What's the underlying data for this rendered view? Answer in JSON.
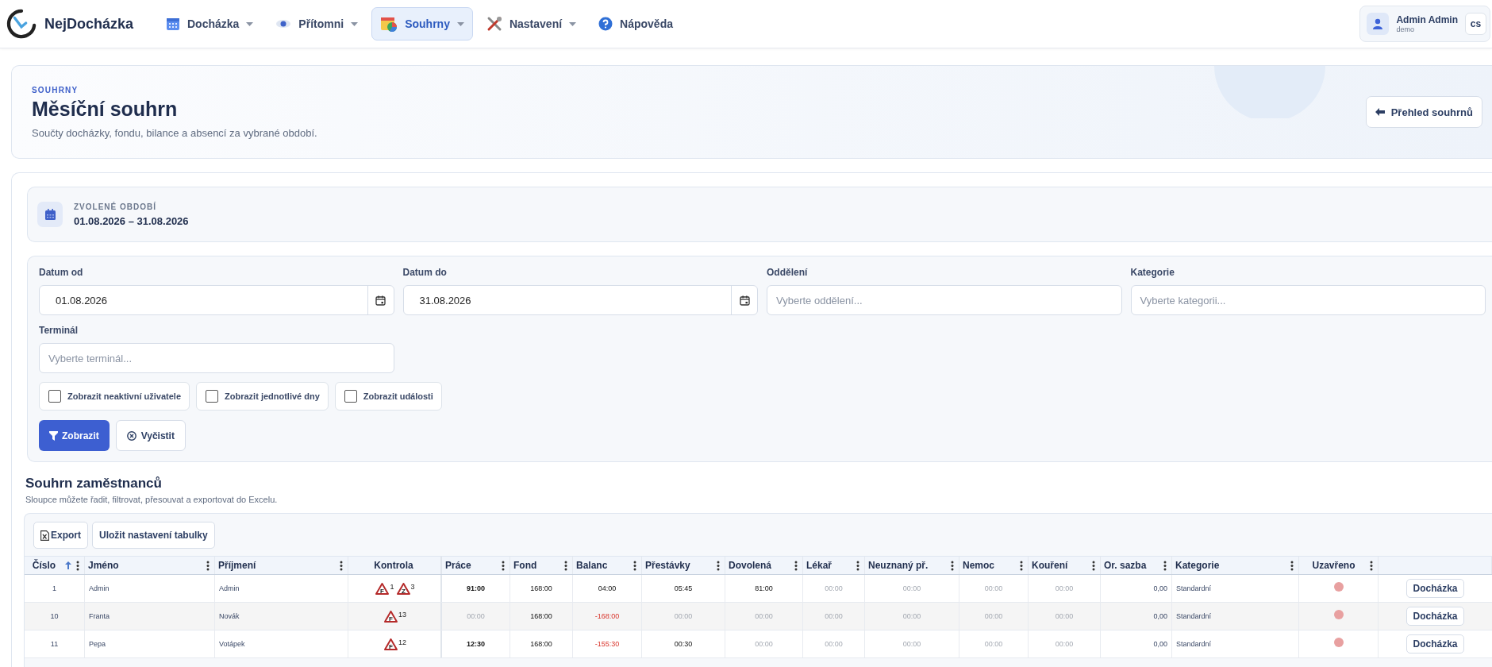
{
  "brand": {
    "name": "NejDocházka"
  },
  "nav": [
    {
      "label": "Docházka",
      "has_menu": true,
      "selected": false
    },
    {
      "label": "Přítomni",
      "has_menu": true,
      "selected": false
    },
    {
      "label": "Souhrny",
      "has_menu": true,
      "selected": true
    },
    {
      "label": "Nastavení",
      "has_menu": true,
      "selected": false
    },
    {
      "label": "Nápověda",
      "has_menu": false,
      "selected": false
    }
  ],
  "user": {
    "name": "Admin Admin",
    "company": "demo",
    "language": "cs"
  },
  "header": {
    "eyebrow": "SOUHRNY",
    "title": "Měsíční souhrn",
    "subtitle": "Součty docházky, fondu, bilance a absencí za vybrané období.",
    "back_button": "Přehled souhrnů"
  },
  "period": {
    "label": "ZVOLENÉ OBDOBÍ",
    "value": "01.08.2026 – 31.08.2026"
  },
  "filters": {
    "fields": [
      {
        "label": "Datum od",
        "kind": "date",
        "value": "01.08.2026"
      },
      {
        "label": "Datum do",
        "kind": "date",
        "value": "31.08.2026"
      },
      {
        "label": "Oddělení",
        "kind": "select",
        "placeholder": "Vyberte oddělení..."
      },
      {
        "label": "Kategorie",
        "kind": "select",
        "placeholder": "Vyberte kategorii..."
      },
      {
        "label": "Terminál",
        "kind": "select",
        "placeholder": "Vyberte terminál..."
      }
    ],
    "checkboxes": [
      {
        "label": "Zobrazit neaktivní uživatele",
        "checked": false
      },
      {
        "label": "Zobrazit jednotlivé dny",
        "checked": false
      },
      {
        "label": "Zobrazit události",
        "checked": false
      }
    ],
    "submit": "Zobrazit",
    "clear": "Vyčistit"
  },
  "summary": {
    "title": "Souhrn zaměstnanců",
    "subtitle": "Sloupce můžete řadit, filtrovat, přesouvat a exportovat do Excelu.",
    "export_button": "Export",
    "save_button": "Uložit nastavení tabulky",
    "columns": [
      {
        "label": "Číslo",
        "sorted_ascending": true,
        "menu": true
      },
      {
        "label": "Jméno",
        "menu": true
      },
      {
        "label": "Příjmení",
        "menu": true
      },
      {
        "label": "Kontrola",
        "menu": false
      },
      {
        "label": "Práce",
        "menu": true
      },
      {
        "label": "Fond",
        "menu": true
      },
      {
        "label": "Balanc",
        "menu": true
      },
      {
        "label": "Přestávky",
        "menu": true
      },
      {
        "label": "Dovolená",
        "menu": true
      },
      {
        "label": "Lékař",
        "menu": true
      },
      {
        "label": "Neuznaný př.",
        "menu": true
      },
      {
        "label": "Nemoc",
        "menu": true
      },
      {
        "label": "Kouření",
        "menu": true
      },
      {
        "label": "Or. sazba",
        "menu": true
      },
      {
        "label": "Kategorie",
        "menu": true
      },
      {
        "label": "Uzavřeno",
        "menu": true
      }
    ],
    "rows": [
      {
        "number": "1",
        "first_name": "Admin",
        "last_name": "Admin",
        "checks": [
          {
            "letter": "F",
            "count": "1"
          },
          {
            "letter": "Z",
            "count": "3"
          }
        ],
        "values": [
          {
            "text": "91:00",
            "kind": "bold"
          },
          {
            "text": "168:00",
            "kind": "normal"
          },
          {
            "text": "04:00",
            "kind": "normal"
          },
          {
            "text": "05:45",
            "kind": "normal"
          },
          {
            "text": "81:00",
            "kind": "normal"
          },
          {
            "text": "00:00",
            "kind": "muted"
          },
          {
            "text": "00:00",
            "kind": "muted"
          },
          {
            "text": "00:00",
            "kind": "muted"
          },
          {
            "text": "00:00",
            "kind": "muted"
          }
        ],
        "rate": "0,00",
        "category": "Standardní",
        "closed": false,
        "action": "Docházka"
      },
      {
        "number": "10",
        "first_name": "Franta",
        "last_name": "Novák",
        "checks": [
          {
            "letter": "F",
            "count": "13"
          }
        ],
        "values": [
          {
            "text": "00:00",
            "kind": "muted"
          },
          {
            "text": "168:00",
            "kind": "normal"
          },
          {
            "text": "-168:00",
            "kind": "negative"
          },
          {
            "text": "00:00",
            "kind": "muted"
          },
          {
            "text": "00:00",
            "kind": "muted"
          },
          {
            "text": "00:00",
            "kind": "muted"
          },
          {
            "text": "00:00",
            "kind": "muted"
          },
          {
            "text": "00:00",
            "kind": "muted"
          },
          {
            "text": "00:00",
            "kind": "muted"
          }
        ],
        "rate": "0,00",
        "category": "Standardní",
        "closed": false,
        "action": "Docházka"
      },
      {
        "number": "11",
        "first_name": "Pepa",
        "last_name": "Votápek",
        "checks": [
          {
            "letter": "F",
            "count": "12"
          }
        ],
        "values": [
          {
            "text": "12:30",
            "kind": "bold"
          },
          {
            "text": "168:00",
            "kind": "normal"
          },
          {
            "text": "-155:30",
            "kind": "negative"
          },
          {
            "text": "00:30",
            "kind": "normal"
          },
          {
            "text": "00:00",
            "kind": "muted"
          },
          {
            "text": "00:00",
            "kind": "muted"
          },
          {
            "text": "00:00",
            "kind": "muted"
          },
          {
            "text": "00:00",
            "kind": "muted"
          },
          {
            "text": "00:00",
            "kind": "muted"
          }
        ],
        "rate": "0,00",
        "category": "Standardní",
        "closed": false,
        "action": "Docházka"
      }
    ]
  }
}
